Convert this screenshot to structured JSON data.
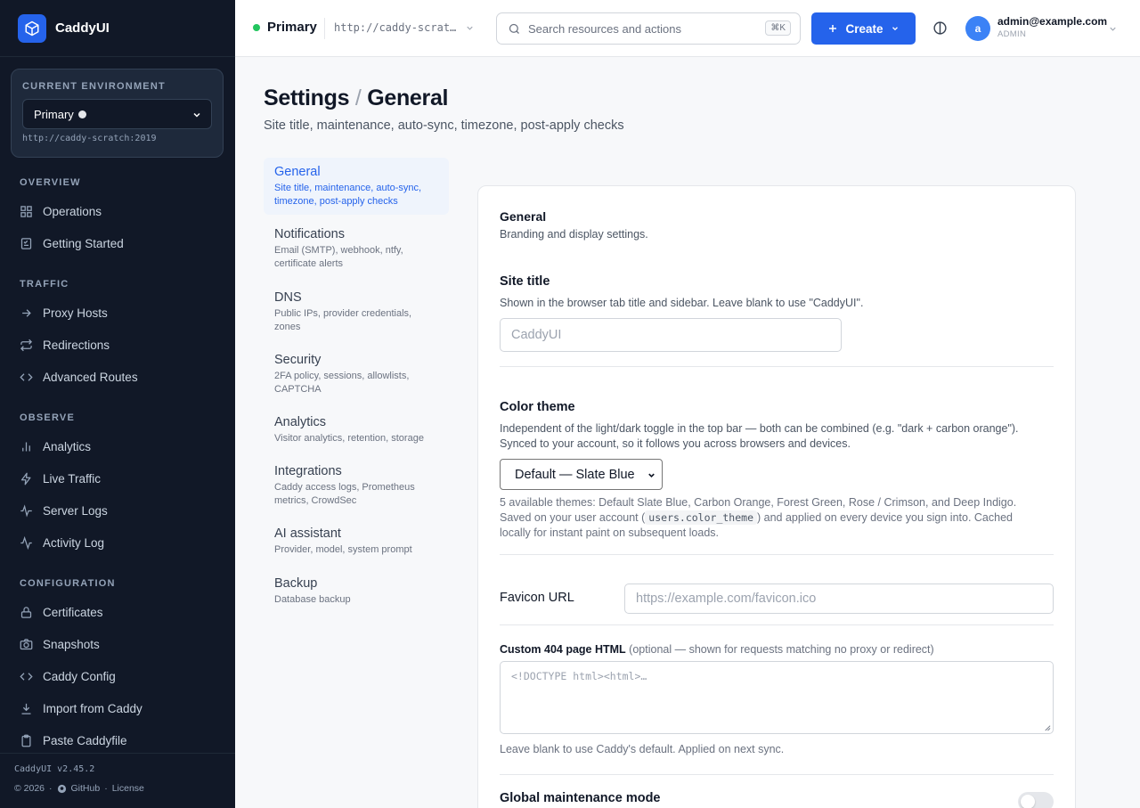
{
  "app": {
    "name": "CaddyUI",
    "version": "CaddyUI v2.45.2",
    "copyright": "© 2026",
    "github": "GitHub",
    "license": "License",
    "separator": "·"
  },
  "environment": {
    "label": "CURRENT ENVIRONMENT",
    "name": "Primary",
    "url": "http://caddy-scratch:2019",
    "url_truncated": "http://caddy-scrat…"
  },
  "sidebar": {
    "sections": [
      {
        "title": "OVERVIEW",
        "items": [
          {
            "label": "Operations",
            "icon": "grid-icon"
          },
          {
            "label": "Getting Started",
            "icon": "checklist-icon"
          }
        ]
      },
      {
        "title": "TRAFFIC",
        "items": [
          {
            "label": "Proxy Hosts",
            "icon": "arrow-right-icon"
          },
          {
            "label": "Redirections",
            "icon": "repeat-icon"
          },
          {
            "label": "Advanced Routes",
            "icon": "code-icon"
          }
        ]
      },
      {
        "title": "OBSERVE",
        "items": [
          {
            "label": "Analytics",
            "icon": "bar-chart-icon"
          },
          {
            "label": "Live Traffic",
            "icon": "zap-icon"
          },
          {
            "label": "Server Logs",
            "icon": "pulse-icon"
          },
          {
            "label": "Activity Log",
            "icon": "activity-icon"
          }
        ]
      },
      {
        "title": "CONFIGURATION",
        "items": [
          {
            "label": "Certificates",
            "icon": "lock-icon"
          },
          {
            "label": "Snapshots",
            "icon": "camera-icon"
          },
          {
            "label": "Caddy Config",
            "icon": "code-icon"
          },
          {
            "label": "Import from Caddy",
            "icon": "download-icon"
          },
          {
            "label": "Paste Caddyfile",
            "icon": "clipboard-icon"
          }
        ]
      }
    ]
  },
  "topbar": {
    "search_placeholder": "Search resources and actions",
    "search_shortcut": "⌘K",
    "create_label": "Create",
    "user_initial": "a",
    "user_email": "admin@example.com",
    "user_role": "ADMIN"
  },
  "page": {
    "title_main": "Settings",
    "title_sep": "/",
    "title_sub": "General",
    "subtitle": "Site title, maintenance, auto-sync, timezone, post-apply checks"
  },
  "settings_nav": [
    {
      "title": "General",
      "desc": "Site title, maintenance, auto-sync, timezone, post-apply checks",
      "active": true
    },
    {
      "title": "Notifications",
      "desc": "Email (SMTP), webhook, ntfy, certificate alerts"
    },
    {
      "title": "DNS",
      "desc": "Public IPs, provider credentials, zones"
    },
    {
      "title": "Security",
      "desc": "2FA policy, sessions, allowlists, CAPTCHA"
    },
    {
      "title": "Analytics",
      "desc": "Visitor analytics, retention, storage"
    },
    {
      "title": "Integrations",
      "desc": "Caddy access logs, Prometheus metrics, CrowdSec"
    },
    {
      "title": "AI assistant",
      "desc": "Provider, model, system prompt"
    },
    {
      "title": "Backup",
      "desc": "Database backup"
    }
  ],
  "form": {
    "section_title": "General",
    "section_desc": "Branding and display settings.",
    "site_title": {
      "label": "Site title",
      "help": "Shown in the browser tab title and sidebar. Leave blank to use \"CaddyUI\".",
      "placeholder": "CaddyUI"
    },
    "color_theme": {
      "label": "Color theme",
      "help_line1": "Independent of the light/dark toggle in the top bar — both can be combined (e.g. \"dark + carbon orange\").",
      "help_line2": "Synced to your account, so it follows you across browsers and devices.",
      "selected": "Default — Slate Blue",
      "note_line1": "5 available themes: Default Slate Blue, Carbon Orange, Forest Green, Rose / Crimson, and Deep Indigo.",
      "note_before_code": "Saved on your user account (",
      "note_code": "users.color_theme",
      "note_after_code": ") and applied on every device you sign into. Cached",
      "note_line3": "locally for instant paint on subsequent loads."
    },
    "favicon": {
      "label": "Favicon URL",
      "placeholder": "https://example.com/favicon.ico"
    },
    "custom_404": {
      "label": "Custom 404 page HTML",
      "label_note": "(optional — shown for requests matching no proxy or redirect)",
      "placeholder": "<!DOCTYPE html><html>…",
      "help": "Leave blank to use Caddy's default. Applied on next sync."
    },
    "maintenance": {
      "label": "Global maintenance mode",
      "enabled": false
    }
  }
}
